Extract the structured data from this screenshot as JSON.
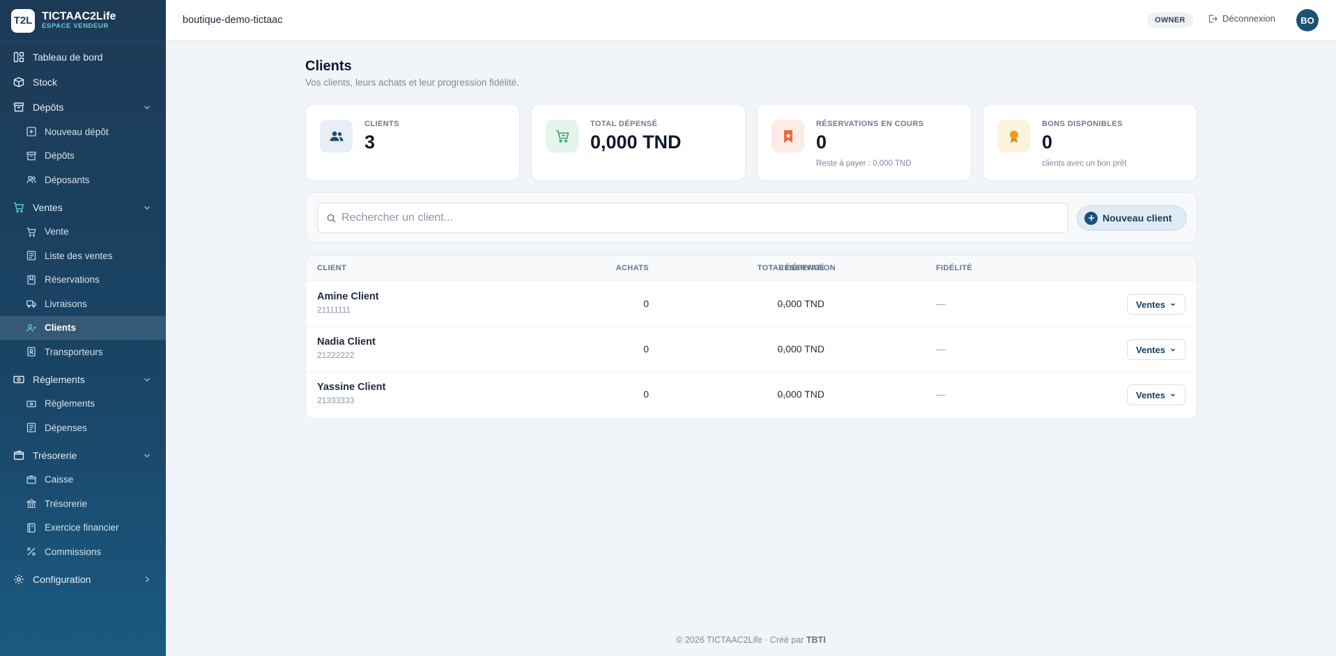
{
  "brand": {
    "logo": "T2L",
    "name": "TICTAAC2Life",
    "subtitle": "ESPACE VENDEUR"
  },
  "nav": {
    "dashboard": "Tableau de bord",
    "stock": "Stock",
    "depots": {
      "label": "Dépôts",
      "items": [
        "Nouveau dépôt",
        "Dépôts",
        "Déposants"
      ]
    },
    "ventes": {
      "label": "Ventes",
      "items": [
        "Vente",
        "Liste des ventes",
        "Réservations",
        "Livraisons",
        "Clients",
        "Transporteurs"
      ]
    },
    "reglements": {
      "label": "Règlements",
      "items": [
        "Règlements",
        "Dépenses"
      ]
    },
    "tresorerie": {
      "label": "Trésorerie",
      "items": [
        "Caisse",
        "Trésorerie",
        "Exercice financier",
        "Commissions"
      ]
    },
    "configuration": "Configuration",
    "active": "Clients"
  },
  "topbar": {
    "shop": "boutique-demo-tictaac",
    "role": "OWNER",
    "logout": "Déconnexion",
    "avatar": "BO"
  },
  "page": {
    "title": "Clients",
    "subtitle": "Vos clients, leurs achats et leur progression fidélité."
  },
  "stats": [
    {
      "label": "CLIENTS",
      "value": "3",
      "note": ""
    },
    {
      "label": "TOTAL DÉPENSÉ",
      "value": "0,000 TND",
      "note": ""
    },
    {
      "label": "RÉSERVATIONS EN COURS",
      "value": "0",
      "note": "Reste à payer : 0,000 TND"
    },
    {
      "label": "BONS DISPONIBLES",
      "value": "0",
      "note": "clients avec un bon prêt"
    }
  ],
  "search": {
    "placeholder": "Rechercher un client...",
    "value": ""
  },
  "new_client_button": "Nouveau client",
  "table": {
    "headers": {
      "client": "CLIENT",
      "achats": "ACHATS",
      "total": "TOTAL DÉPENSÉ",
      "reservation": "RÉSERVATION",
      "fidelite": "FIDÉLITÉ"
    },
    "action_label": "Ventes",
    "rows": [
      {
        "name": "Amine Client",
        "phone": "21111111",
        "achats": "0",
        "total": "0,000 TND",
        "reservation": "—",
        "fidelite": "—"
      },
      {
        "name": "Nadia Client",
        "phone": "21222222",
        "achats": "0",
        "total": "0,000 TND",
        "reservation": "—",
        "fidelite": "—"
      },
      {
        "name": "Yassine Client",
        "phone": "21333333",
        "achats": "0",
        "total": "0,000 TND",
        "reservation": "—",
        "fidelite": "—"
      }
    ]
  },
  "footer": {
    "text": "© 2026 TICTAAC2Life · Créé par",
    "author": "TBTI"
  },
  "colors": {
    "sidebar": "#1c3a56",
    "accent": "#5fd0d8",
    "primary": "#1b5078",
    "background": "#f1f4f8"
  }
}
